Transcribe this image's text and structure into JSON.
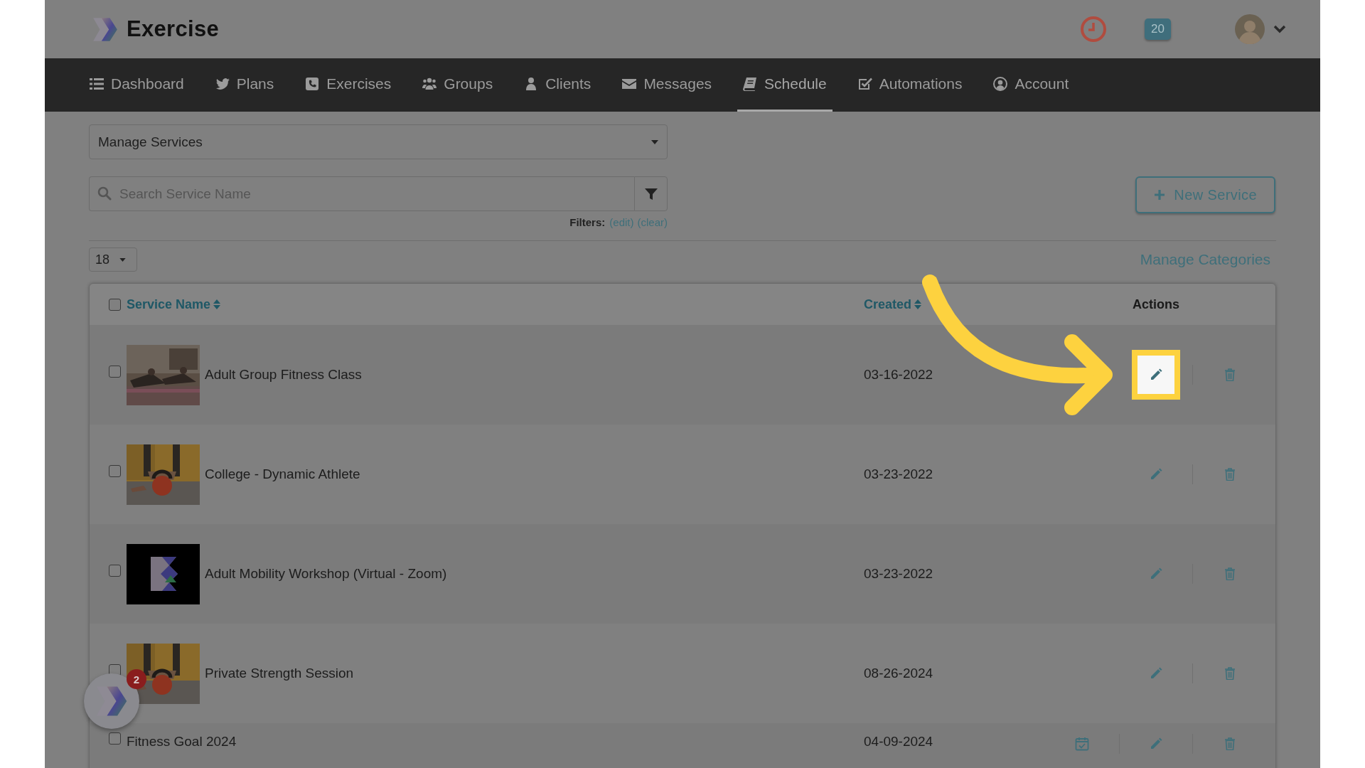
{
  "header": {
    "app_name": "Exercise",
    "notification_count": "20"
  },
  "nav": [
    {
      "label": "Dashboard",
      "selected": false
    },
    {
      "label": "Plans",
      "selected": false
    },
    {
      "label": "Exercises",
      "selected": false
    },
    {
      "label": "Groups",
      "selected": false
    },
    {
      "label": "Clients",
      "selected": false
    },
    {
      "label": "Messages",
      "selected": false
    },
    {
      "label": "Schedule",
      "selected": true
    },
    {
      "label": "Automations",
      "selected": false
    },
    {
      "label": "Account",
      "selected": false
    }
  ],
  "service_select": {
    "value": "Manage Services"
  },
  "search": {
    "placeholder": "Search Service Name"
  },
  "filters": {
    "label": "Filters:",
    "links": [
      "(edit)",
      "(clear)"
    ]
  },
  "new_service_button": "New Service",
  "page_size": {
    "value": "18"
  },
  "manage_categories": "Manage Categories",
  "table": {
    "select_all_checked": false,
    "columns": [
      {
        "label": "Service Name",
        "sortable": true
      },
      {
        "label": "Created",
        "sortable": true
      },
      {
        "label": "Actions",
        "sortable": false
      }
    ],
    "rows": [
      {
        "name": "Adult Group Fitness Class",
        "created": "03-16-2022",
        "checked": false,
        "thumbnail": {
          "kind": "picture"
        },
        "actions": [
          {
            "kind": "edit",
            "highlighted": true
          },
          {
            "kind": "delete",
            "highlighted": false
          }
        ]
      },
      {
        "name": "College - Dynamic Athlete",
        "created": "03-23-2022",
        "checked": false,
        "thumbnail": {
          "kind": "picture"
        },
        "actions": [
          {
            "kind": "edit",
            "highlighted": false
          },
          {
            "kind": "delete",
            "highlighted": false
          }
        ]
      },
      {
        "name": "Adult Mobility Workshop (Virtual - Zoom)",
        "created": "03-23-2022",
        "checked": false,
        "thumbnail": {
          "kind": "picture"
        },
        "actions": [
          {
            "kind": "edit",
            "highlighted": false
          },
          {
            "kind": "delete",
            "highlighted": false
          }
        ]
      },
      {
        "name": "Private Strength Session",
        "created": "08-26-2024",
        "checked": false,
        "thumbnail": {
          "kind": "picture"
        },
        "actions": [
          {
            "kind": "edit",
            "highlighted": false
          },
          {
            "kind": "delete",
            "highlighted": false
          }
        ]
      },
      {
        "name": "Fitness Goal 2024",
        "created": "04-09-2024",
        "checked": false,
        "actions": [
          {
            "kind": "schedule",
            "highlighted": false
          },
          {
            "kind": "edit",
            "highlighted": false
          },
          {
            "kind": "delete",
            "highlighted": false
          }
        ]
      }
    ]
  },
  "launcher": {
    "badge": "2"
  }
}
